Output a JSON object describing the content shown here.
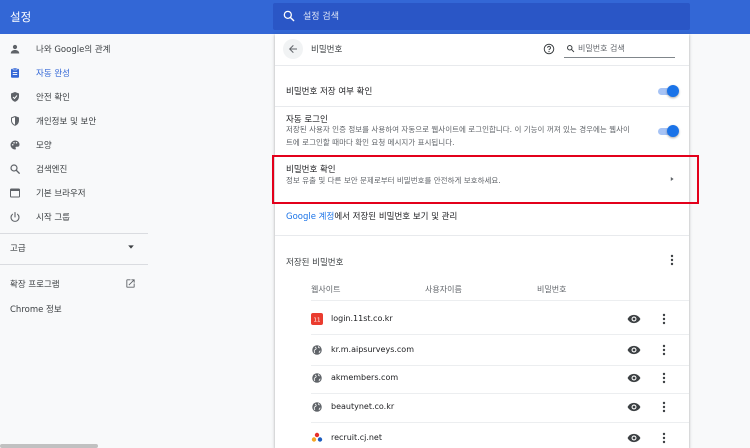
{
  "app": {
    "title": "설정"
  },
  "search": {
    "placeholder": "설정 검색"
  },
  "sidebar": {
    "items": [
      {
        "label": "나와 Google의 관계",
        "icon": "person-icon"
      },
      {
        "label": "자동 완성",
        "icon": "clipboard-icon",
        "selected": true
      },
      {
        "label": "안전 확인",
        "icon": "shield-check-icon"
      },
      {
        "label": "개인정보 및 보안",
        "icon": "shield-icon"
      },
      {
        "label": "모양",
        "icon": "palette-icon"
      },
      {
        "label": "검색엔진",
        "icon": "search-icon"
      },
      {
        "label": "기본 브라우저",
        "icon": "browser-icon"
      },
      {
        "label": "시작 그룹",
        "icon": "power-icon"
      }
    ],
    "advanced": "고급",
    "extensions": "확장 프로그램",
    "about": "Chrome 정보"
  },
  "passwords": {
    "title": "비밀번호",
    "search_placeholder": "비밀번호 검색",
    "offer_to_save": "비밀번호 저장 여부 확인",
    "auto_signin": {
      "title": "자동 로그인",
      "desc": "저장된 사용자 인증 정보를 사용하여 자동으로 웹사이트에 로그인합니다. 이 기능이 꺼져 있는 경우에는 웹사이트에 로그인할 때마다 확인 요청 메시지가 표시됩니다."
    },
    "check": {
      "title": "비밀번호 확인",
      "desc": "정보 유출 및 다른 보안 문제로부터 비밀번호를 안전하게 보호하세요."
    },
    "google_account_link": "Google 계정",
    "google_account_rest": "에서 저장된 비밀번호 보기 및 관리",
    "saved_title": "저장된 비밀번호",
    "columns": {
      "site": "웹사이트",
      "username": "사용자이름",
      "password": "비밀번호"
    },
    "entries": [
      {
        "site": "login.11st.co.kr",
        "favicon": "11st-icon"
      },
      {
        "site": "kr.m.aipsurveys.com",
        "favicon": "globe-icon"
      },
      {
        "site": "akmembers.com",
        "favicon": "globe-icon"
      },
      {
        "site": "beautynet.co.kr",
        "favicon": "globe-icon"
      },
      {
        "site": "recruit.cj.net",
        "favicon": "cj-icon"
      }
    ]
  },
  "colors": {
    "header": "#3367d6",
    "accent": "#1a73e8",
    "highlight": "#e3001b"
  }
}
